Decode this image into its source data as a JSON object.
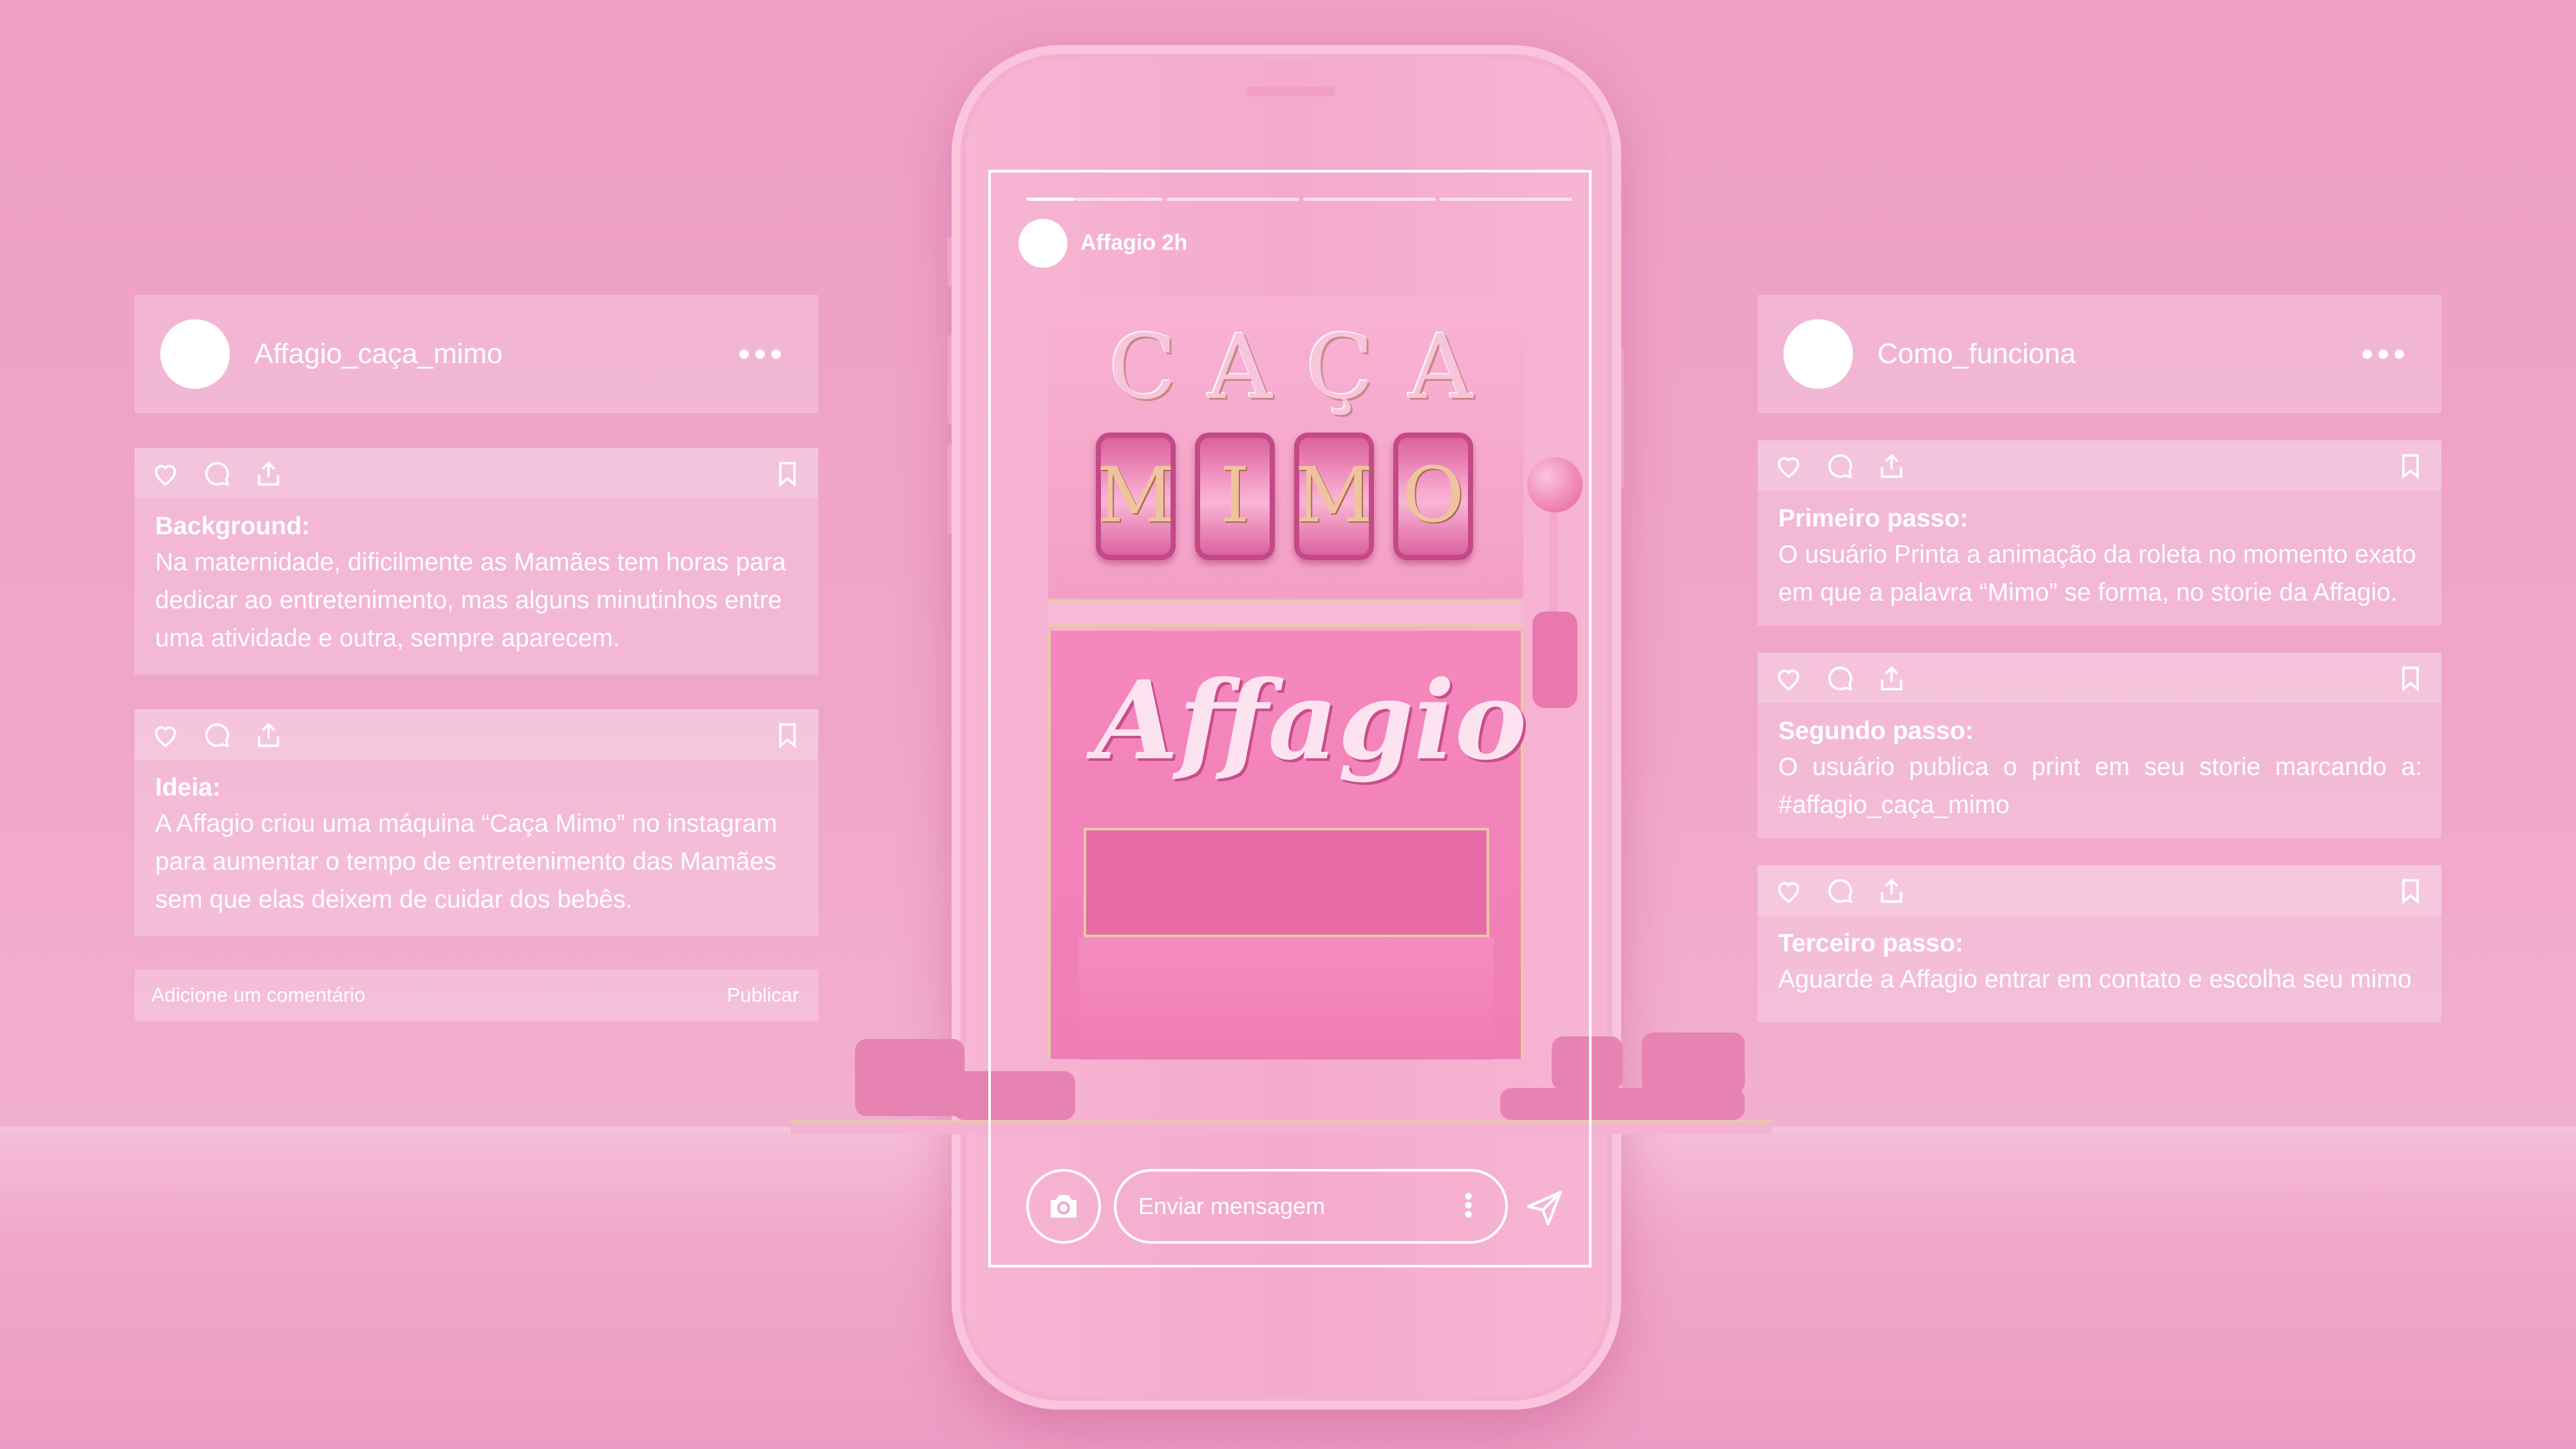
{
  "left_panel": {
    "username": "Affagio_caça_mimo",
    "more_icon": "•••",
    "post1": {
      "title": "Background:",
      "lines": [
        "Na maternidade, dificilmente as Mamães tem horas para",
        "dedicar ao entretenimento, mas alguns minutinhos entre",
        "uma atividade e outra, sempre aparecem."
      ]
    },
    "post2": {
      "title": "Ideia:",
      "lines": [
        "A Affagio criou uma máquina “Caça Mimo” no instagram",
        "para aumentar o tempo de entretenimento das Mamães",
        "sem que elas deixem de cuidar dos bebês."
      ]
    },
    "comment": {
      "placeholder": "Adicione um comentário",
      "publish": "Publicar"
    }
  },
  "right_panel": {
    "username": "Como_funciona",
    "more_icon": "•••",
    "step1": {
      "title": "Primeiro passo:",
      "lines": [
        "O usuário Printa a animação da roleta no momento exato",
        "em que a palavra “Mimo” se forma, no storie da Affagio."
      ]
    },
    "step2": {
      "title": "Segundo passo:",
      "lines": [
        "O usuário publica o print em seu storie marcando a:",
        "#affagio_caça_mimo"
      ]
    },
    "step3": {
      "title": "Terceiro passo:",
      "lines": [
        "Aguarde a Affagio entrar em contato e escolha seu mimo"
      ]
    }
  },
  "story": {
    "header": "Affagio 2h",
    "progress_segments": 4,
    "active_segment": 1,
    "machine": {
      "top_letters": [
        "C",
        "A",
        "Ç",
        "A"
      ],
      "reels": [
        "M",
        "I",
        "M",
        "O"
      ],
      "brand": "Affagio"
    },
    "message_placeholder": "Enviar mensagem"
  },
  "colors": {
    "background": "#f0a6ca",
    "panel_text": "#ffffff",
    "machine_pink": "#f07db6",
    "gold_accent": "#e9c9a6"
  },
  "icons": [
    "heart-icon",
    "comment-icon",
    "share-icon",
    "bookmark-icon",
    "more-icon",
    "camera-icon",
    "kebab-icon",
    "send-icon"
  ]
}
